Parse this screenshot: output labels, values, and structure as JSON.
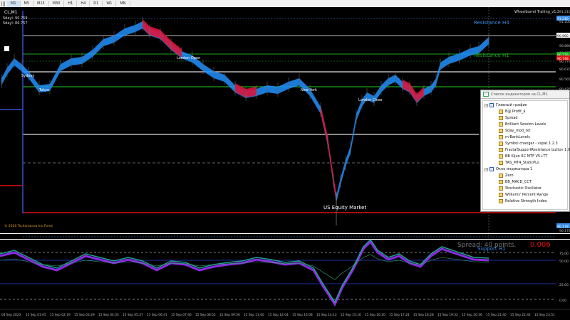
{
  "toolbar": {
    "timeframes": [
      "M1",
      "M5",
      "M15",
      "M30",
      "H1",
      "H4",
      "D1",
      "W1",
      "MN"
    ],
    "active": "M1"
  },
  "chart": {
    "symbol_line": "CL,M1",
    "info_lines": [
      "Sdayl: 90.759",
      "Sdayl: 86.757"
    ],
    "indicator_header": "Wheelbarrel Trailing_v1.2",
    "copyright": "© 2020 Tschamansa Inc.Forex",
    "labels": {
      "resistance_h4": "Resistance H4",
      "resistance_h1": "Resistance H1",
      "support_h1": "Support H1",
      "us_equity": "US Equity Market",
      "new_york": "New York",
      "london": "London Close",
      "tokyo": "Tokyo",
      "sydney": "Sydney",
      "london_open": "London Open"
    },
    "spread_text": "Spread: 40 points.",
    "spread_value": "0.006",
    "price_axis": [
      "91.210",
      "91.100",
      "90.960",
      "90.880",
      "90.860",
      "90.779",
      "90.670",
      "90.565",
      "90.425",
      "90.295",
      "90.178"
    ],
    "price_tags": {
      "white": "90.960",
      "green": "90.779",
      "red": "90.748",
      "blue_top": "91.240",
      "blue_bottom": "90.178"
    },
    "osc_axis": [
      "75.00",
      "50.00",
      "25.00",
      "0.00"
    ],
    "time_axis": [
      "04 Sep 2023",
      "15 Sep 01:05",
      "15 Sep 02:19",
      "15 Sep 03:29",
      "15 Sep 04:33",
      "15 Sep 05:37",
      "15 Sep 06:41",
      "15 Sep 07:46",
      "15 Sep 08:52",
      "15 Sep 09:56",
      "15 Sep 11:00",
      "15 Sep 12:04",
      "15 Sep 13:08",
      "15 Sep 14:12",
      "15 Sep 15:16",
      "15 Sep 16:20",
      "15 Sep 17:24",
      "15 Sep 18:28",
      "15 Sep 19:32",
      "15 Sep 20:36",
      "15 Sep 21:40",
      "15 Sep 22:44",
      "15 Sep 23:51"
    ]
  },
  "colors": {
    "bull": "#1e90ff",
    "bear": "#dc143c",
    "green_line": "#1fa81f",
    "red_line": "#e01010",
    "blue_line": "#2040d0",
    "osc_teal": "#20b0a0",
    "osc_purple": "#8a2be2"
  },
  "indicators_window": {
    "title": "Список индикаторов на CL,M1",
    "main_chart": "Главный график",
    "main_items": [
      "B@.Profit_$",
      "Spread",
      "Brilliant Session Levels",
      "Sday_mod_txt",
      "m-BankLevels",
      "Symbol changer - vspat 1.2.3",
      "FractalSupportResistance button 1.05",
      "BB Kijun 6C MTF V5+TT",
      "TAS_MT4_StaticPLs"
    ],
    "sub_window": "Окно индикатора 1",
    "sub_items": [
      "Zero",
      "BB_MACD_CCT",
      "Stochastic Oscillator",
      "Williams' Percent Range",
      "Relative Strength Index"
    ]
  }
}
